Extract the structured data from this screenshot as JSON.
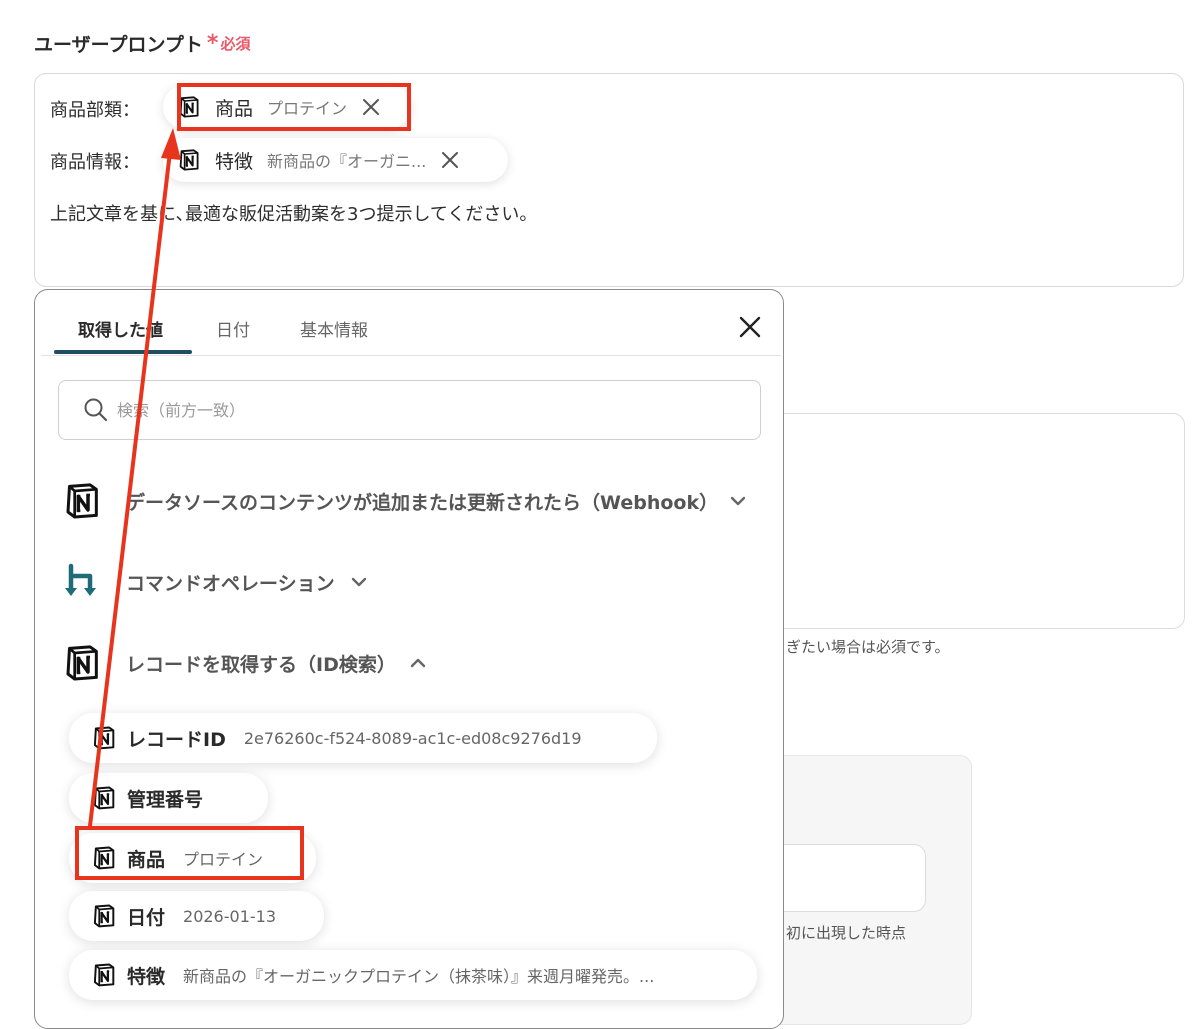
{
  "field": {
    "label": "ユーザープロンプト",
    "required_star": "*",
    "required_text": "必須"
  },
  "prompt": {
    "line1_label": "商品部類：",
    "line1_chip": {
      "key": "商品",
      "value": "プロテイン"
    },
    "line2_label": "商品情報：",
    "line2_chip": {
      "key": "特徴",
      "value": "新商品の『オーガニ..."
    },
    "text": "上記文章を基に､最適な販促活動案を3つ提示してください。"
  },
  "background": {
    "hint1": "ぎたい場合は必須です。",
    "hint2": "初に出現した時点"
  },
  "popover": {
    "tabs": [
      "取得した値",
      "日付",
      "基本情報"
    ],
    "search_placeholder": "検索（前方一致）",
    "sections": [
      {
        "title": "データソースのコンテンツが追加または更新されたら（Webhook）",
        "icon": "notion-icon",
        "state": "collapsed"
      },
      {
        "title": "コマンドオペレーション",
        "icon": "command-operation-icon",
        "state": "collapsed"
      },
      {
        "title": "レコードを取得する（ID検索）",
        "icon": "notion-icon",
        "state": "expanded"
      }
    ],
    "items": [
      {
        "key": "レコードID",
        "value": "2e76260c-f524-8089-ac1c-ed08c9276d19"
      },
      {
        "key": "管理番号",
        "value": ""
      },
      {
        "key": "商品",
        "value": "プロテイン"
      },
      {
        "key": "日付",
        "value": "2026-01-13"
      },
      {
        "key": "特徴",
        "value": "新商品の『オーガニックプロテイン（抹茶味）』来週月曜発売。..."
      }
    ]
  },
  "colors": {
    "accent": "#1f4e64",
    "required": "#e85a6a",
    "annotation": "#e8341c",
    "command_icon": "#1f6b7a"
  }
}
